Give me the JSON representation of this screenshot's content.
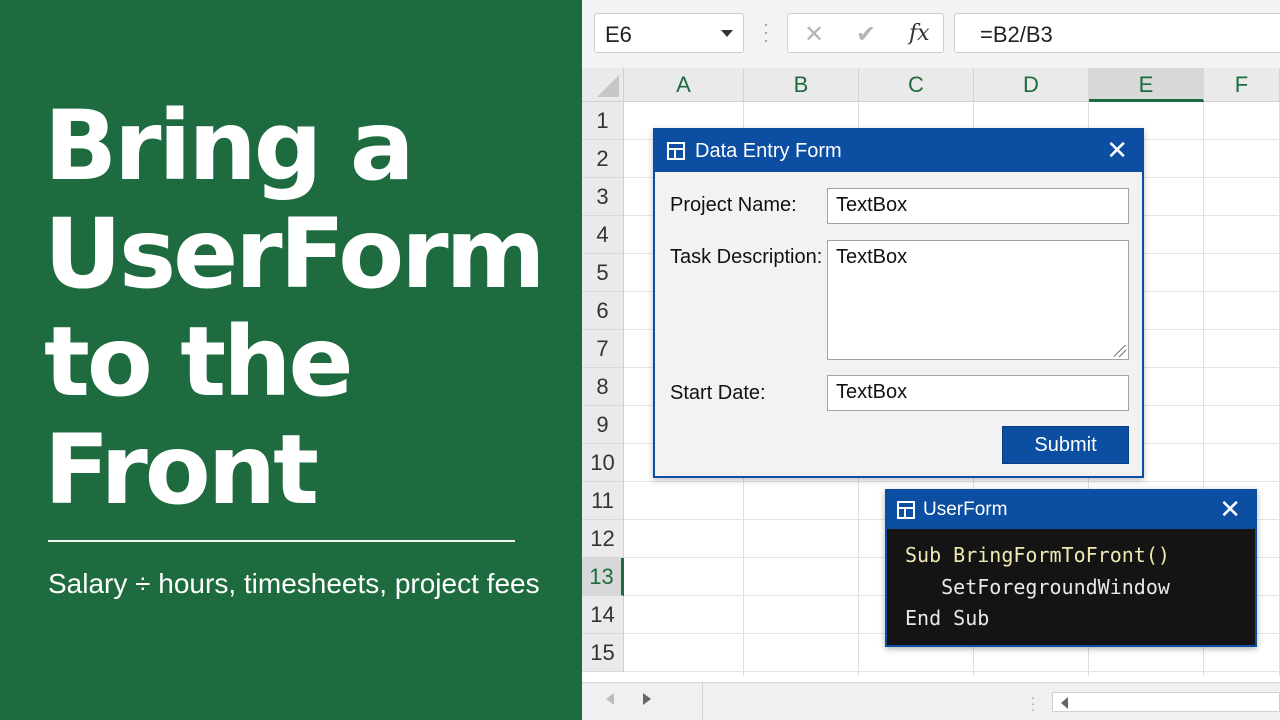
{
  "headline": [
    "Bring a",
    "UserForm",
    "to the",
    "Front"
  ],
  "subtitle": "Salary ÷ hours, timesheets, project fees",
  "colors": {
    "brand_green": "#1d6b3e",
    "dialog_blue": "#0b4ea2",
    "code_bg": "#141414",
    "code_keyword": "#f0e8b0",
    "code_text": "#e8e8e8"
  },
  "excel": {
    "name_box": "E6",
    "formula_icons": {
      "cancel": "✕",
      "enter": "✔",
      "fx": "fx"
    },
    "formula": "=B2/B3",
    "columns": [
      "A",
      "B",
      "C",
      "D",
      "E",
      "F"
    ],
    "active_column": "E",
    "rows": [
      "1",
      "2",
      "3",
      "4",
      "5",
      "6",
      "7",
      "8",
      "9",
      "10",
      "11",
      "12",
      "13",
      "14",
      "15"
    ],
    "active_row": "13"
  },
  "data_entry_form": {
    "title": "Data Entry Form",
    "close": "✕",
    "fields": [
      {
        "label": "Project Name:",
        "value": "TextBox"
      },
      {
        "label": "Task Description:",
        "value": "TextBox"
      },
      {
        "label": "Start Date:",
        "value": "TextBox"
      }
    ],
    "submit_label": "Submit"
  },
  "code_window": {
    "title": "UserForm",
    "close": "✕",
    "lines": [
      "Sub BringFormToFront()",
      "   SetForegroundWindow",
      "End Sub"
    ]
  }
}
